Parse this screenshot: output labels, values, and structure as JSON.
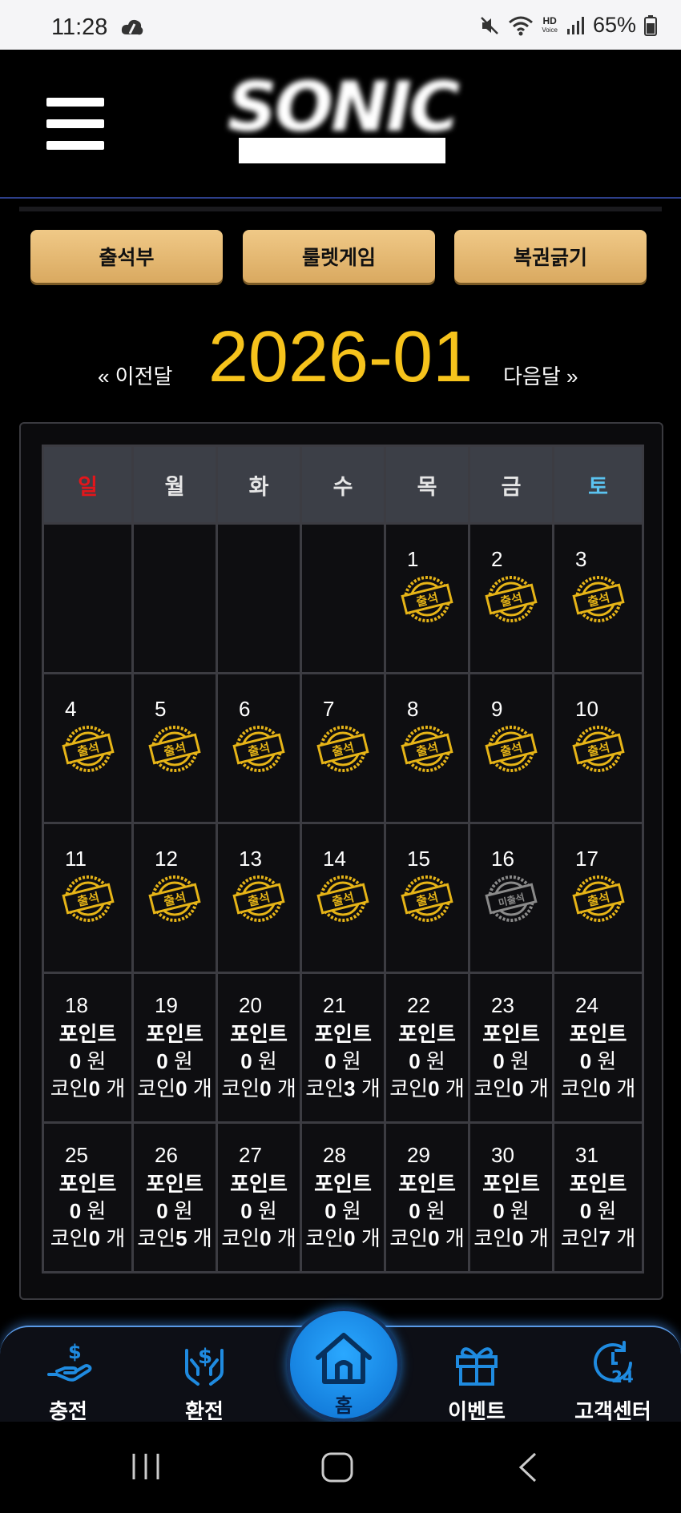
{
  "status_bar": {
    "time": "11:28",
    "battery": "65%",
    "hd_top": "HD",
    "hd_bottom": "Voice"
  },
  "header": {
    "logo_text": "SONIC"
  },
  "top_buttons": {
    "attendance": "출석부",
    "roulette": "룰렛게임",
    "lottery": "복권긁기"
  },
  "month_nav": {
    "prev": "« 이전달",
    "current": "2026-01",
    "next": "다음달 »"
  },
  "calendar": {
    "weekdays": [
      "일",
      "월",
      "화",
      "수",
      "목",
      "금",
      "토"
    ],
    "weekday_colors": [
      "#e3161b",
      "#e6e6e6",
      "#e6e6e6",
      "#e6e6e6",
      "#e6e6e6",
      "#e6e6e6",
      "#5bc3f0"
    ],
    "stamp_attend": "출석",
    "stamp_absent": "미출석",
    "point_label": "포인트",
    "won_unit": "원",
    "coin_label": "코인",
    "coin_unit": "개",
    "days": [
      {
        "d": "1",
        "s": "attend"
      },
      {
        "d": "2",
        "s": "attend"
      },
      {
        "d": "3",
        "s": "attend"
      },
      {
        "d": "4",
        "s": "attend"
      },
      {
        "d": "5",
        "s": "attend"
      },
      {
        "d": "6",
        "s": "attend"
      },
      {
        "d": "7",
        "s": "attend"
      },
      {
        "d": "8",
        "s": "attend"
      },
      {
        "d": "9",
        "s": "attend"
      },
      {
        "d": "10",
        "s": "attend"
      },
      {
        "d": "11",
        "s": "attend"
      },
      {
        "d": "12",
        "s": "attend"
      },
      {
        "d": "13",
        "s": "attend"
      },
      {
        "d": "14",
        "s": "attend"
      },
      {
        "d": "15",
        "s": "attend"
      },
      {
        "d": "16",
        "s": "absent"
      },
      {
        "d": "17",
        "s": "attend"
      },
      {
        "d": "18",
        "s": "info",
        "points": "0",
        "coins": "0"
      },
      {
        "d": "19",
        "s": "info",
        "points": "0",
        "coins": "0"
      },
      {
        "d": "20",
        "s": "info",
        "points": "0",
        "coins": "0"
      },
      {
        "d": "21",
        "s": "info",
        "points": "0",
        "coins": "3"
      },
      {
        "d": "22",
        "s": "info",
        "points": "0",
        "coins": "0"
      },
      {
        "d": "23",
        "s": "info",
        "points": "0",
        "coins": "0"
      },
      {
        "d": "24",
        "s": "info",
        "points": "0",
        "coins": "0"
      },
      {
        "d": "25",
        "s": "info",
        "points": "0",
        "coins": "0"
      },
      {
        "d": "26",
        "s": "info",
        "points": "0",
        "coins": "5"
      },
      {
        "d": "27",
        "s": "info",
        "points": "0",
        "coins": "0"
      },
      {
        "d": "28",
        "s": "info",
        "points": "0",
        "coins": "0"
      },
      {
        "d": "29",
        "s": "info",
        "points": "0",
        "coins": "0"
      },
      {
        "d": "30",
        "s": "info",
        "points": "0",
        "coins": "0"
      },
      {
        "d": "31",
        "s": "info",
        "points": "0",
        "coins": "7"
      }
    ],
    "leading_blanks": 4
  },
  "bottom_nav": {
    "deposit": "충전",
    "withdraw": "환전",
    "home": "홈",
    "event": "이벤트",
    "support": "고객센터",
    "support_badge": "24"
  },
  "colors": {
    "accent_gold": "#f6c31c",
    "button_gold": "#e8bb72",
    "nav_blue": "#1a8ee8"
  }
}
